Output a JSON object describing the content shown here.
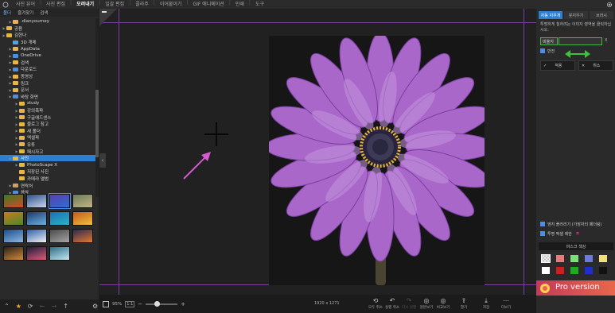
{
  "menu": {
    "tabs": [
      "사진 뷰어",
      "사진 편집",
      "오려내기",
      "일괄 편집",
      "콜라주",
      "이어붙이기",
      "GIF 애니메이션",
      "인쇄",
      "도구"
    ],
    "active_tab_index": 2
  },
  "left_panel": {
    "tabs": [
      "폴더",
      "즐겨찾기",
      "검색"
    ],
    "tree": [
      {
        "label": ".dianyourney",
        "indent": 2,
        "icon": "folder",
        "arrow": true
      },
      {
        "label": "공용",
        "indent": 1,
        "icon": "folder",
        "arrow": true
      },
      {
        "label": "김현나",
        "indent": 1,
        "icon": "folder-open",
        "arrow": true
      },
      {
        "label": "3D 개체",
        "indent": 2,
        "icon": "cube",
        "arrow": false
      },
      {
        "label": "AppData",
        "indent": 2,
        "icon": "folder",
        "arrow": true
      },
      {
        "label": "OneDrive",
        "indent": 2,
        "icon": "cloud",
        "arrow": true
      },
      {
        "label": "검색",
        "indent": 2,
        "icon": "folder",
        "arrow": true
      },
      {
        "label": "다운로드",
        "indent": 2,
        "icon": "download",
        "arrow": true
      },
      {
        "label": "동영상",
        "indent": 2,
        "icon": "folder",
        "arrow": true
      },
      {
        "label": "링크",
        "indent": 2,
        "icon": "folder",
        "arrow": true
      },
      {
        "label": "문서",
        "indent": 2,
        "icon": "folder",
        "arrow": true
      },
      {
        "label": "바탕 화면",
        "indent": 2,
        "icon": "desktop",
        "arrow": true
      },
      {
        "label": "study",
        "indent": 3,
        "icon": "folder",
        "arrow": true
      },
      {
        "label": "강의폭파",
        "indent": 3,
        "icon": "folder",
        "arrow": true
      },
      {
        "label": "구글애드센스",
        "indent": 3,
        "icon": "folder",
        "arrow": true
      },
      {
        "label": "블로그 참고",
        "indent": 3,
        "icon": "folder",
        "arrow": true
      },
      {
        "label": "새 폴더",
        "indent": 3,
        "icon": "folder",
        "arrow": true
      },
      {
        "label": "엑셀파",
        "indent": 3,
        "icon": "folder",
        "arrow": true
      },
      {
        "label": "유튜",
        "indent": 3,
        "icon": "folder",
        "arrow": true
      },
      {
        "label": "패시자고",
        "indent": 3,
        "icon": "folder",
        "arrow": true
      },
      {
        "label": "사진",
        "indent": 2,
        "icon": "folder-open",
        "arrow": true,
        "selected": true
      },
      {
        "label": "PhotoScape X",
        "indent": 3,
        "icon": "folder",
        "arrow": true
      },
      {
        "label": "저장된 사진",
        "indent": 3,
        "icon": "folder",
        "arrow": false
      },
      {
        "label": "카메라 앨범",
        "indent": 3,
        "icon": "folder",
        "arrow": false
      },
      {
        "label": "연락처",
        "indent": 2,
        "icon": "contacts",
        "arrow": true
      },
      {
        "label": "음악",
        "indent": 2,
        "icon": "music",
        "arrow": true
      }
    ],
    "thumbnails": [
      {
        "colors": [
          "#3b7a1f",
          "#d24a2a"
        ]
      },
      {
        "colors": [
          "#2a4f8a",
          "#c9d6ea"
        ]
      },
      {
        "colors": [
          "#5a3fb0",
          "#2c6fd1"
        ],
        "selected": true
      },
      {
        "colors": [
          "#6b7b5a",
          "#c4b487"
        ]
      },
      {
        "colors": [
          "#c97a1e",
          "#4a8a2a"
        ]
      },
      {
        "colors": [
          "#1b3b6a",
          "#6db0e0"
        ]
      },
      {
        "colors": [
          "#1d6fb0",
          "#2ab5c8"
        ]
      },
      {
        "colors": [
          "#c45a1a",
          "#f0c040"
        ]
      },
      {
        "colors": [
          "#1a4d8a",
          "#8fb6e0"
        ]
      },
      {
        "colors": [
          "#2e5fa8",
          "#f2f2f2"
        ]
      },
      {
        "colors": [
          "#4a4a4a",
          "#a5a5a5"
        ]
      },
      {
        "colors": [
          "#2a2a4f",
          "#e07a30"
        ]
      },
      {
        "colors": [
          "#2a2018",
          "#d28b3b"
        ]
      },
      {
        "colors": [
          "#1b1f3a",
          "#e05a7a"
        ]
      },
      {
        "colors": [
          "#2a6f8a",
          "#c9e6ef"
        ]
      }
    ]
  },
  "canvas": {
    "zoom_percent": "95%",
    "fit_label": "1:1",
    "zoom_level": 0.35,
    "image_size": "1920 x 1271"
  },
  "toolbar": [
    {
      "icon": "undo-all-icon",
      "glyph": "⟲",
      "label": "모두 취소"
    },
    {
      "icon": "undo-icon",
      "glyph": "↶",
      "label": "실행 취소"
    },
    {
      "icon": "redo-icon",
      "glyph": "↷",
      "label": "다시 실행",
      "disabled": true
    },
    {
      "icon": "compare-icon",
      "glyph": "◎",
      "label": "원본보기"
    },
    {
      "icon": "compare2-icon",
      "glyph": "◎",
      "label": "비교보기"
    },
    {
      "icon": "open-icon",
      "glyph": "⇪",
      "label": "열기"
    },
    {
      "icon": "save-icon",
      "glyph": "⤓",
      "label": "저장"
    },
    {
      "icon": "more-icon",
      "glyph": "⋯",
      "label": "더보기"
    }
  ],
  "right_panel": {
    "tabs": [
      "자동 지우개",
      "붓지우기",
      "브러시"
    ],
    "active_tab_index": 0,
    "description": "투명하게 칠하려는 이미지 영역을 클릭하십시오.",
    "ratio_select": "비율지",
    "ratio_x": "X",
    "check_label": "반전",
    "apply_label": "적용",
    "cancel_label": "취소",
    "check2_label": "엔지 플러리기 (가장자리 페더링)",
    "check3_label": "투명 픽셀 제한",
    "mask_color_label": "마스크 색상",
    "swatches": [
      "checker",
      "#e77a7a",
      "#7ae07a",
      "#6a7ae0",
      "#f0e07a",
      "#ffffff",
      "#cc1f1f",
      "#1faa1f",
      "#1f2fcc",
      "#111111"
    ],
    "ad_text": "Pro version"
  }
}
